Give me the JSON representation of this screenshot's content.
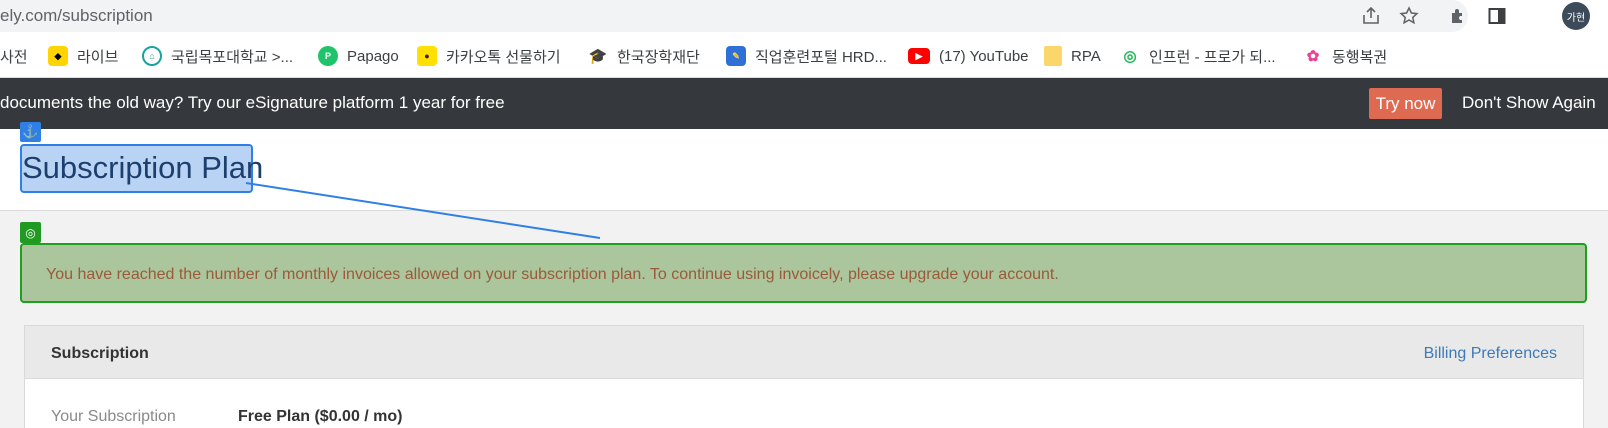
{
  "browser": {
    "url": "ely.com/subscription",
    "avatar_text": "가현",
    "bookmarks": [
      {
        "label": "사전"
      },
      {
        "label": "라이브"
      },
      {
        "label": "국립목포대학교 >..."
      },
      {
        "label": "Papago"
      },
      {
        "label": "카카오톡 선물하기"
      },
      {
        "label": "한국장학재단"
      },
      {
        "label": "직업훈련포털 HRD..."
      },
      {
        "label": "(17) YouTube"
      },
      {
        "label": "RPA"
      },
      {
        "label": "인프런 - 프로가 되..."
      },
      {
        "label": "동행복권"
      }
    ]
  },
  "promo": {
    "text": "documents the old way? Try our eSignature platform 1 year for free",
    "try_label": "Try now",
    "dismiss_label": "Don't Show Again"
  },
  "page": {
    "title": "Subscription Plan",
    "alert": "You have reached the number of monthly invoices allowed on your subscription plan. To continue using invoicely, please upgrade your account."
  },
  "subscription_card": {
    "heading": "Subscription",
    "billing_link": "Billing Preferences",
    "row_label": "Your Subscription",
    "row_value": "Free Plan ($0.00 / mo)"
  },
  "annotations": {
    "anchor_badge_icon": "anchor-icon",
    "target_badge_icon": "target-icon",
    "title_color": "#2f7fe6",
    "alert_color": "#1e9f20"
  }
}
